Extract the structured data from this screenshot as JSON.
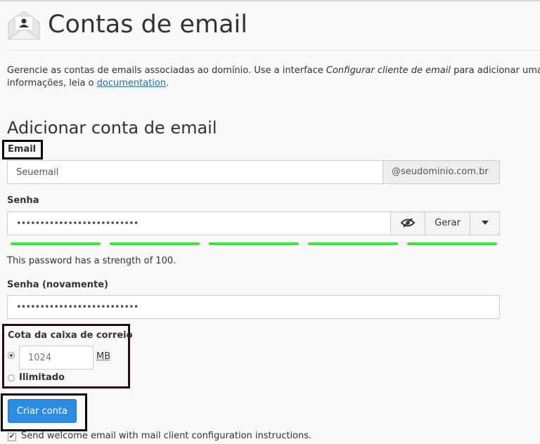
{
  "header": {
    "title": "Contas de email",
    "icon": "envelope-person-icon"
  },
  "intro": {
    "text_before": "Gerencie as contas de emails associadas ao domínio. Use a interface ",
    "text_em": "Configurar cliente de email",
    "text_after": " para adicionar uma c",
    "line2_before": "informações, leia o ",
    "link": "documentation",
    "line2_after": "."
  },
  "form": {
    "section_title": "Adicionar conta de email",
    "email": {
      "label": "Email",
      "placeholder": "Seuemail",
      "domain_suffix": "@seudominio.com.br"
    },
    "password": {
      "label": "Senha",
      "value": "••••••••••••••••••••••••••",
      "toggle_icon": "eye-slash-icon",
      "generate_label": "Gerar",
      "dropdown_icon": "caret-down-icon",
      "strength_percent": 100,
      "strength_segments": 5,
      "strength_color": "#4ade3a",
      "strength_text": "This password has a strength of 100."
    },
    "password_again": {
      "label": "Senha (novamente)",
      "value": "••••••••••••••••••••••••••"
    },
    "quota": {
      "label": "Cota da caixa de correio",
      "value": "1024",
      "unit": "MB",
      "unlimited_label": "Ilimitado",
      "selected": "quota"
    },
    "submit_label": "Criar conta",
    "submit_color": "#2d8ce0",
    "welcome_checkbox": {
      "checked": true,
      "label": "Send welcome email with mail client configuration instructions."
    }
  }
}
